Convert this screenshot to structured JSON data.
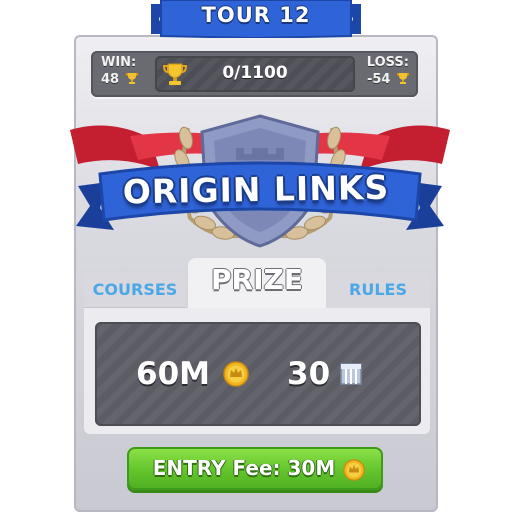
{
  "tour": {
    "label": "TOUR 12"
  },
  "stats": {
    "win_label": "WIN:",
    "win_value": "48",
    "progress_text": "0/1100",
    "loss_label": "LOSS:",
    "loss_value": "-54"
  },
  "title": "ORIGIN LINKS",
  "tabs": [
    {
      "label": "COURSES"
    },
    {
      "label": "PRIZE"
    },
    {
      "label": "RULES"
    }
  ],
  "prize": {
    "coins": "60M",
    "gems": "30"
  },
  "entry_button": {
    "label": "ENTRY Fee: 30M"
  },
  "colors": {
    "banner_blue": "#2f63d8",
    "ribbon_red": "#d9293a",
    "tab_text_blue": "#4ba8e6",
    "button_green": "#63c42c",
    "coin_gold": "#f2b71e"
  },
  "icons": [
    "trophy-icon",
    "coin-icon",
    "gem-icon",
    "laurel-icon",
    "shield-emblem-icon"
  ]
}
